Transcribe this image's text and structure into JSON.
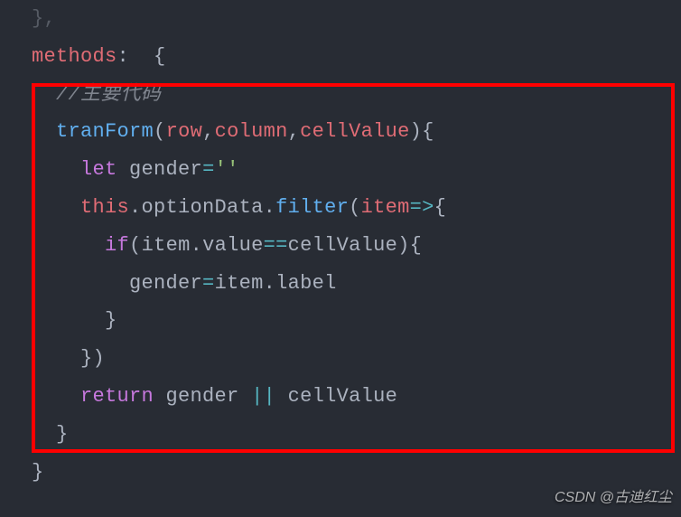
{
  "code": {
    "line0_brace": "  },",
    "line1_methods": "methods",
    "line1_colon": ":",
    "line1_brace": "  {",
    "line2_comment": "//主要代码",
    "line3_fn": "tranForm",
    "line3_p1": "row",
    "line3_p2": "column",
    "line3_p3": "cellValue",
    "line4_let": "let",
    "line4_var": "gender",
    "line4_eq": "=",
    "line4_str": "''",
    "line5_this": "this",
    "line5_prop": "optionData",
    "line5_filter": "filter",
    "line5_item": "item",
    "line5_arrow": "=>",
    "line6_if": "if",
    "line6_item": "item",
    "line6_value": "value",
    "line6_eq": "==",
    "line6_cell": "cellValue",
    "line7_gender": "gender",
    "line7_eq": "=",
    "line7_item": "item",
    "line7_label": "label",
    "line8_brace": "}",
    "line9_close": "})",
    "line10_return": "return",
    "line10_gender": "gender",
    "line10_or": "||",
    "line10_cell": "cellValue",
    "line11_brace": "}",
    "line12_brace": "}"
  },
  "watermark": "CSDN @古迪红尘"
}
